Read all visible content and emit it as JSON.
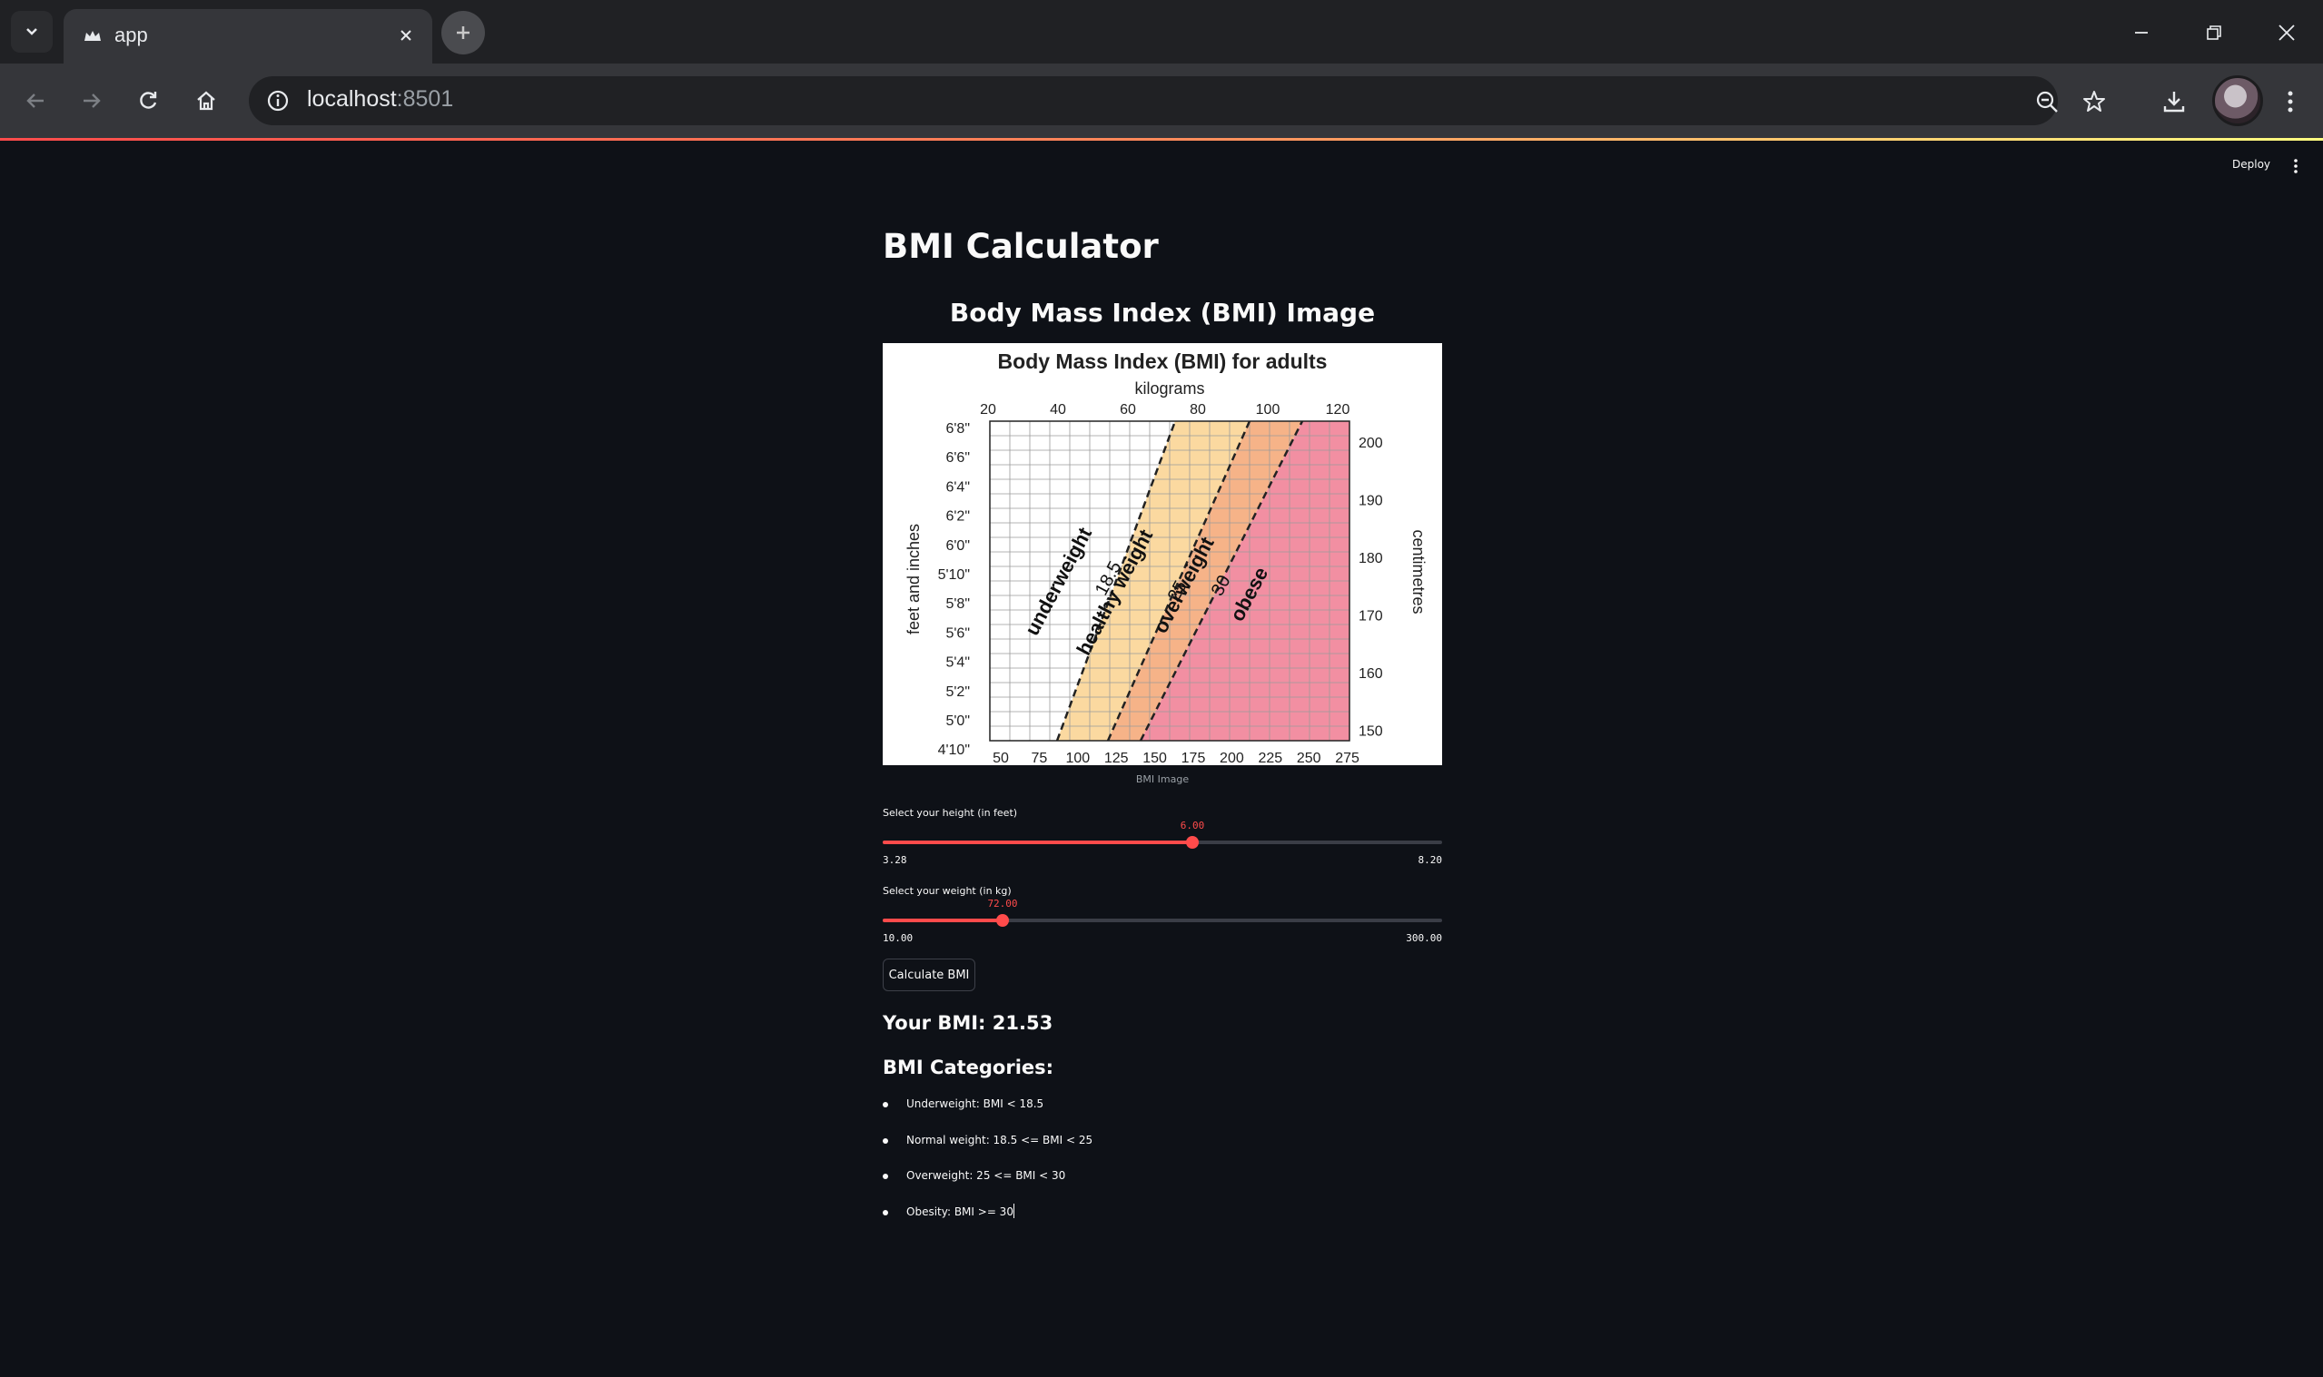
{
  "browser": {
    "tab_title": "app",
    "url_host": "localhost",
    "url_port": ":8501"
  },
  "app": {
    "deploy_label": "Deploy",
    "title": "BMI Calculator",
    "image_heading": "Body Mass Index (BMI) Image",
    "image_caption": "BMI Image",
    "chart_title": "Body Mass Index (BMI) for adults",
    "chart_top_unit": "kilograms",
    "chart_left_unit": "feet and inches",
    "chart_right_unit": "centimetres",
    "chart_top_ticks": [
      "20",
      "40",
      "60",
      "80",
      "100",
      "120"
    ],
    "chart_left_ticks": [
      "6'8\"",
      "6'6\"",
      "6'4\"",
      "6'2\"",
      "6'0\"",
      "5'10\"",
      "5'8\"",
      "5'6\"",
      "5'4\"",
      "5'2\"",
      "5'0\"",
      "4'10\""
    ],
    "chart_right_ticks": [
      "200",
      "190",
      "180",
      "170",
      "160",
      "150"
    ],
    "chart_bottom_ticks": [
      "50",
      "75",
      "100",
      "125",
      "150",
      "175",
      "200",
      "225",
      "250",
      "275"
    ],
    "zone_labels": {
      "underweight": "underweight",
      "healthy": "healthy weight",
      "overweight": "overweight",
      "obese": "obese",
      "line1": "18.5",
      "line2": "25",
      "line3": "30"
    },
    "height_slider": {
      "label": "Select your height (in feet)",
      "value": "6.00",
      "min": "3.28",
      "max": "8.20",
      "fraction": 0.5528
    },
    "weight_slider": {
      "label": "Select your weight (in kg)",
      "value": "72.00",
      "min": "10.00",
      "max": "300.00",
      "fraction": 0.2138
    },
    "button_label": "Calculate BMI",
    "result": "Your BMI: 21.53",
    "categories_title": "BMI Categories:",
    "categories": [
      "Underweight: BMI < 18.5",
      "Normal weight: 18.5 <= BMI < 25",
      "Overweight: 25 <= BMI < 30",
      "Obesity: BMI >= 30"
    ]
  },
  "colors": {
    "accent": "#ff4b4b",
    "background": "#0e1117",
    "zone_healthy": "#fbd9a0",
    "zone_overweight": "#f6b388",
    "zone_obese": "#f28fa2"
  }
}
